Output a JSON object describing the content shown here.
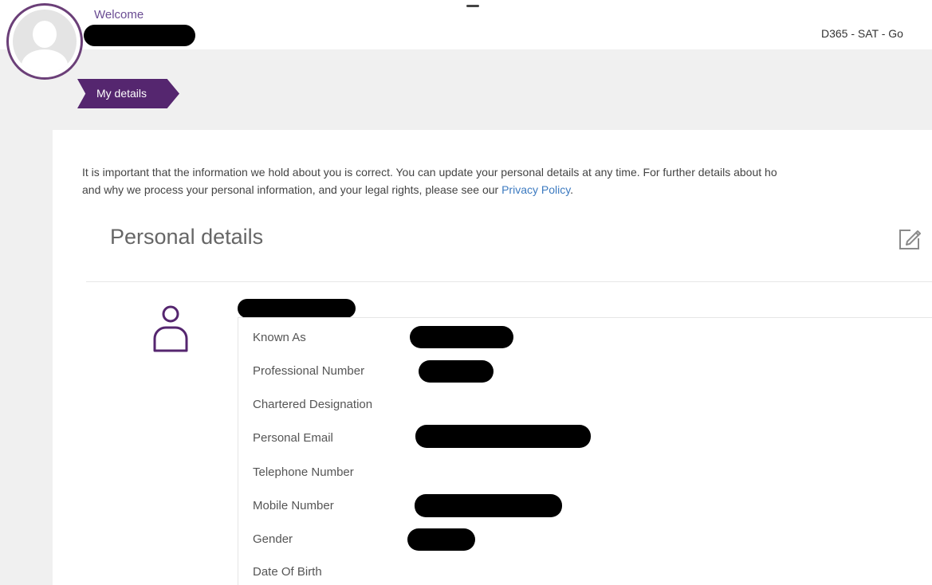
{
  "header": {
    "welcome_text": "Welcome",
    "environment_label": "D365 - SAT - Go"
  },
  "nav": {
    "my_details_label": "My details"
  },
  "intro": {
    "line1": "It is important that the information we hold about you is correct. You can update your personal details at any time. For further details about ho",
    "line2_prefix": "and why we process your personal information, and your legal rights, please see our ",
    "privacy_link": "Privacy Policy",
    "line2_suffix": "."
  },
  "personal_details": {
    "title": "Personal details",
    "fields": [
      {
        "label": "Known As"
      },
      {
        "label": "Professional Number"
      },
      {
        "label": "Chartered Designation"
      },
      {
        "label": "Personal Email"
      },
      {
        "label": "Telephone Number"
      },
      {
        "label": "Mobile Number"
      },
      {
        "label": "Gender"
      },
      {
        "label": "Date Of Birth"
      }
    ]
  },
  "colors": {
    "brand_purple": "#55266f",
    "link_blue": "#3c7ac0",
    "page_background": "#f0f0f0"
  },
  "icons": {
    "avatar": "default-user-avatar",
    "edit": "edit-pencil-icon",
    "person": "person-outline-icon"
  }
}
